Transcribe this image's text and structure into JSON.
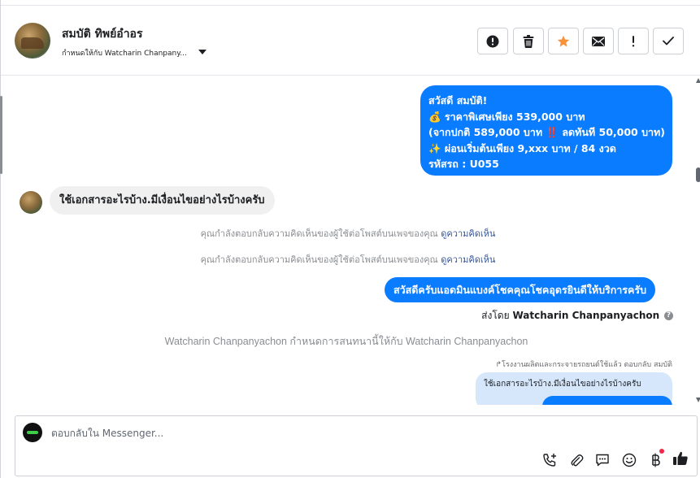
{
  "header": {
    "contact_name": "สมบัติ ทิพย์อำอร",
    "assigned_to": "กำหนดให้กับ Watcharin Chanpany...",
    "actions": [
      "mark-spam",
      "delete",
      "star",
      "mark-unread",
      "follow-up",
      "mark-done"
    ]
  },
  "thread": {
    "message1_lines": [
      "สวัสดี สมบัติ!",
      "💰 ราคาพิเศษเพียง 539,000 บาท",
      "(จากปกติ 589,000 บาท ‼️ ลดทันที 50,000 บาท)",
      "✨ ผ่อนเริ่มต้นเพียง 9,xxx บาท / 84 งวด",
      "รหัสรถ : U055"
    ],
    "incoming_message": "ใช้เอกสารอะไรบ้าง.มีเงื่อนไขอย่างไรบ้างครับ",
    "notice_text": "คุณกำลังตอบกลับความคิดเห็นของผู้ใช้ต่อโพสต์บนเพจของคุณ",
    "notice_link": "ดูความคิดเห็น",
    "message2": "สวัสดีครับแอดมินแบงค์โชคคุณโชคอุดรยินดีให้บริการครับ",
    "sent_by_label": "ส่งโดย",
    "sent_by_name": "Watcharin Chanpanyachon",
    "assign_note": "Watcharin Chanpanyachon กำหนดการสนทนานี้ให้กับ Watcharin Chanpanyachon",
    "reply_meta": "↱โรงงานผลิตและกระจายรถยนต์ใช้แล้ว ตอบกลับ สมบัติ",
    "quoted_text": "ใช้เอกสารอะไรบ้าง.มีเงื่อนไขอย่างไรบ้างครับ"
  },
  "composer": {
    "placeholder": "ตอบกลับใน Messenger...",
    "icons": [
      "add-contact-phone",
      "attachment",
      "saved-reply",
      "emoji",
      "baht-payment",
      "thumbs-up"
    ]
  },
  "colors": {
    "accent": "#0a7cff",
    "star": "#f7923b",
    "link": "#385898",
    "notification_dot": "#f02849"
  }
}
